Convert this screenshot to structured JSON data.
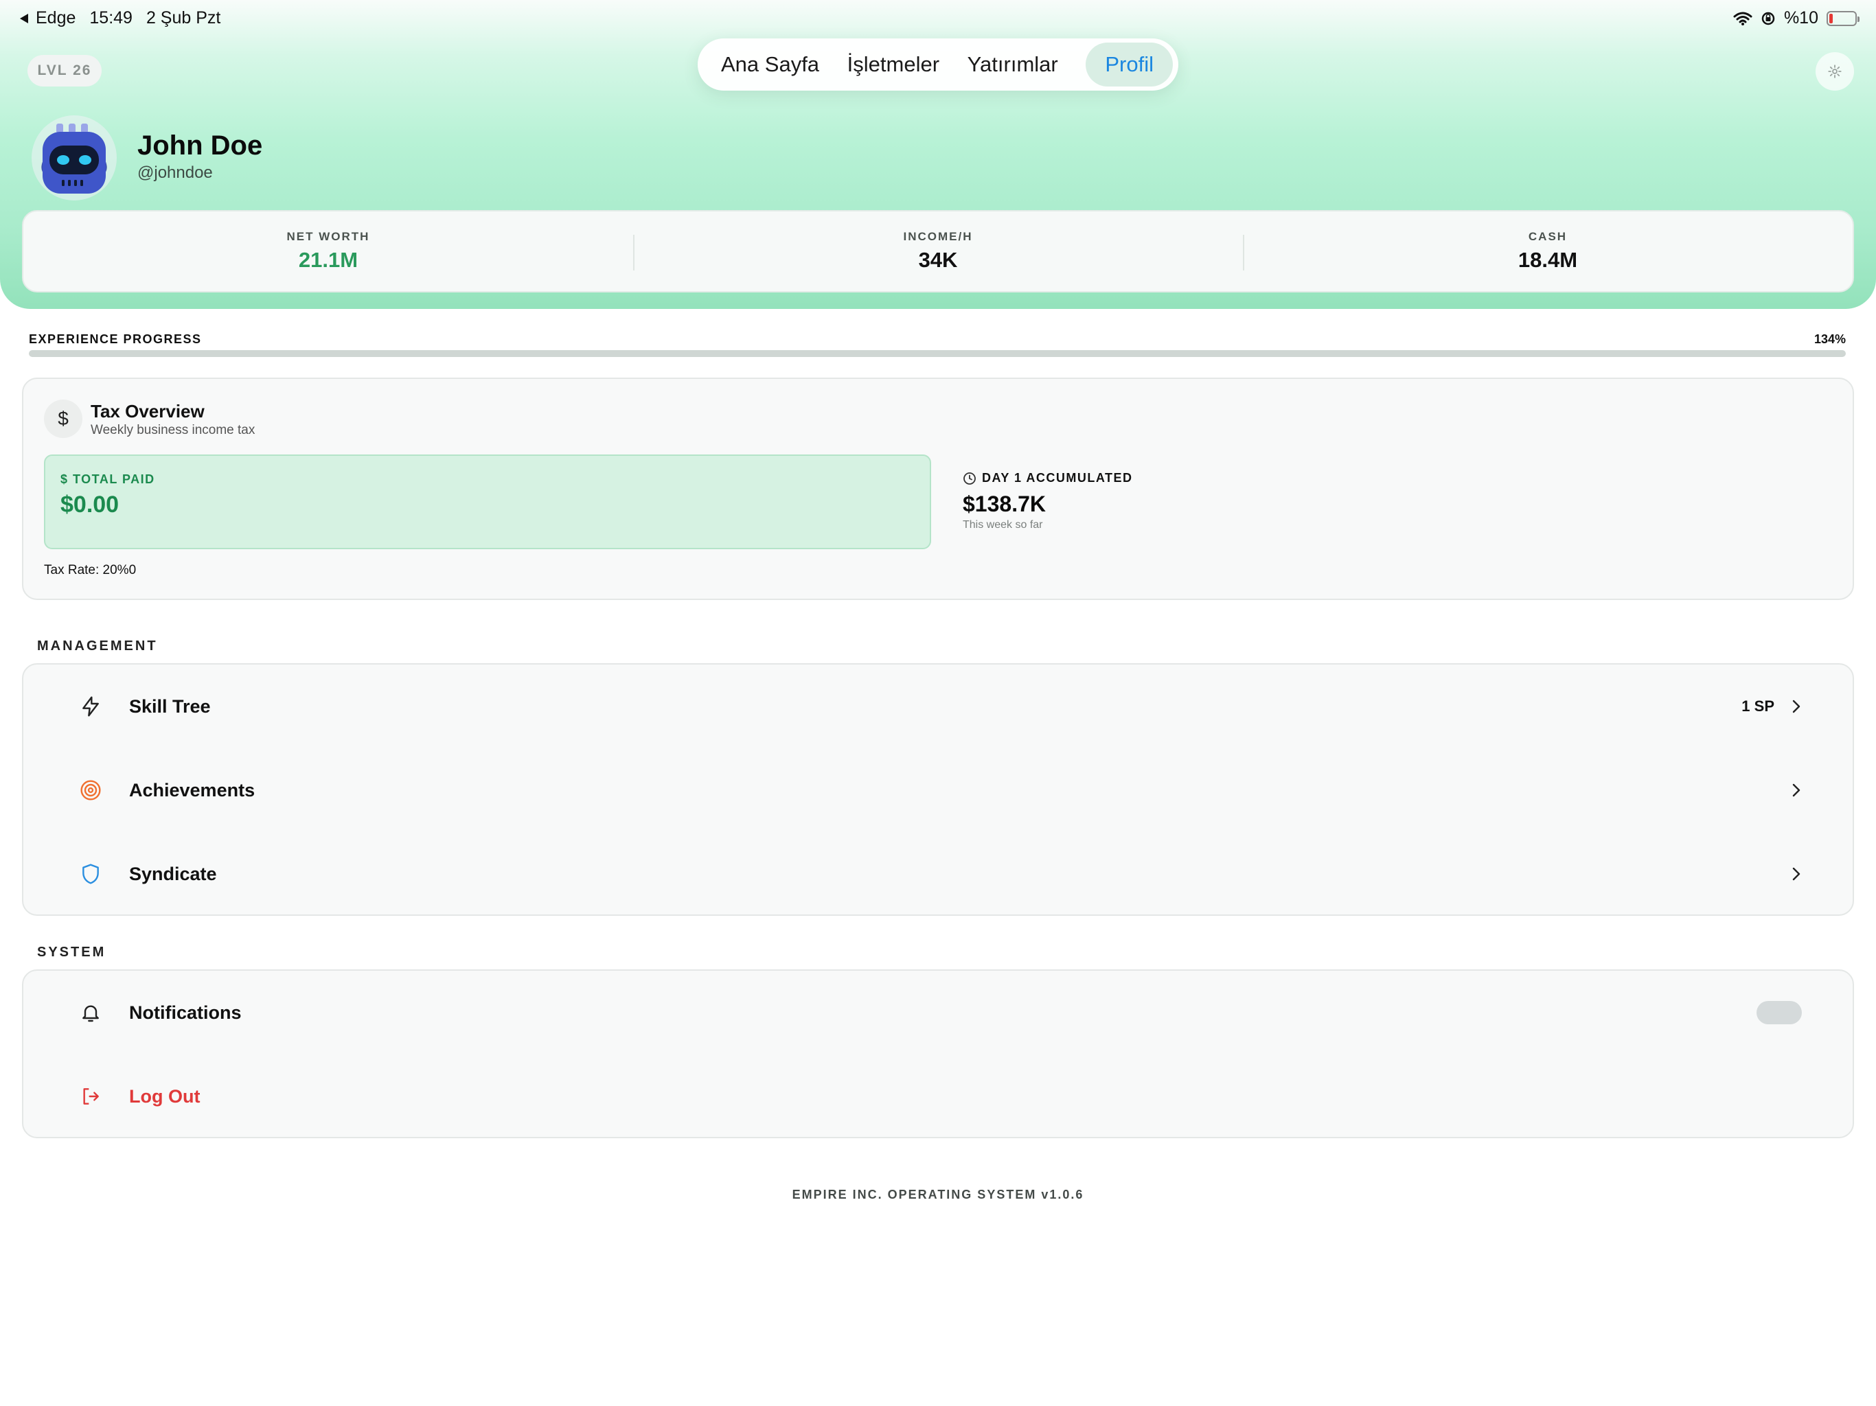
{
  "status_bar": {
    "back_app": "Edge",
    "time": "15:49",
    "date": "2 Şub Pzt",
    "battery": "%10"
  },
  "nav": {
    "tabs": [
      {
        "label": "Ana Sayfa"
      },
      {
        "label": "İşletmeler"
      },
      {
        "label": "Yatırımlar"
      },
      {
        "label": "Profil",
        "active": true
      }
    ]
  },
  "profile": {
    "level": "LVL 26",
    "name": "John Doe",
    "handle": "@johndoe"
  },
  "stats": [
    {
      "label": "NET WORTH",
      "value": "21.1M",
      "color": "#2a9a5c"
    },
    {
      "label": "INCOME/H",
      "value": "34K",
      "color": "#111111"
    },
    {
      "label": "CASH",
      "value": "18.4M",
      "color": "#111111"
    }
  ],
  "experience": {
    "label": "EXPERIENCE PROGRESS",
    "percent_text": "134%",
    "progress": 1.0
  },
  "tax": {
    "icon": "dollar-icon",
    "title": "Tax Overview",
    "subtitle": "Weekly business income tax",
    "total_paid_label": "$ TOTAL PAID",
    "total_paid_value": "$0.00",
    "accumulated_label": "DAY 1 ACCUMULATED",
    "accumulated_value": "$138.7K",
    "accumulated_sub": "This week so far",
    "rate_text": "Tax Rate: 20%0"
  },
  "management": {
    "title": "MANAGEMENT",
    "items": [
      {
        "label": "Skill Tree",
        "badge": "1 SP",
        "icon": "lightning-icon"
      },
      {
        "label": "Achievements",
        "badge": "",
        "icon": "target-icon"
      },
      {
        "label": "Syndicate",
        "badge": "",
        "icon": "shield-icon"
      }
    ]
  },
  "system": {
    "title": "SYSTEM",
    "notifications_label": "Notifications",
    "notifications_on": false,
    "logout_label": "Log Out"
  },
  "footer": "EMPIRE INC. OPERATING SYSTEM v1.0.6",
  "colors": {
    "accent_green": "#2a9a5c",
    "active_tab": "#1a86e0",
    "danger": "#e03a3a",
    "achievement_orange": "#f07030",
    "syndicate_blue": "#2b8fe0"
  }
}
